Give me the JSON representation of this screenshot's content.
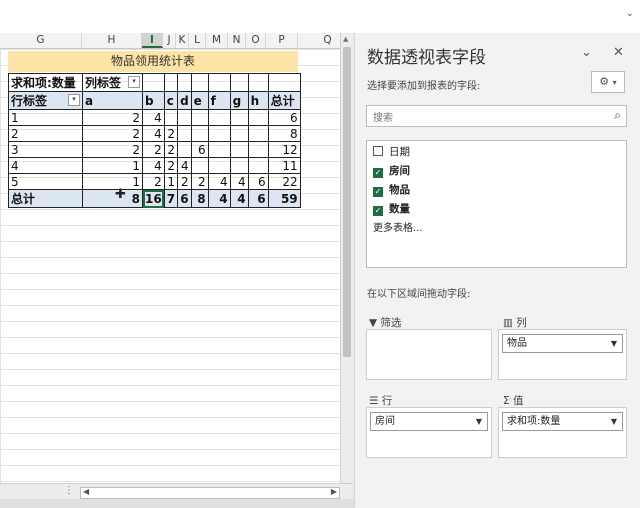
{
  "sheet": {
    "columns": [
      "G",
      "H",
      "I",
      "J",
      "K",
      "L",
      "M",
      "N",
      "O",
      "P",
      "Q"
    ],
    "selected_column": "I",
    "title": "物品领用统计表",
    "pivot": {
      "value_label": "求和项:数量",
      "col_label": "列标签",
      "row_label": "行标签",
      "headers": [
        "a",
        "b",
        "c",
        "d",
        "e",
        "f",
        "g",
        "h",
        "总计"
      ],
      "rows": [
        {
          "label": "1",
          "values": [
            "2",
            "4",
            "",
            "",
            "",
            "",
            "",
            "",
            "6"
          ]
        },
        {
          "label": "2",
          "values": [
            "2",
            "4",
            "2",
            "",
            "",
            "",
            "",
            "",
            "8"
          ]
        },
        {
          "label": "3",
          "values": [
            "2",
            "2",
            "2",
            "",
            "6",
            "",
            "",
            "",
            "12"
          ]
        },
        {
          "label": "4",
          "values": [
            "1",
            "4",
            "2",
            "4",
            "",
            "",
            "",
            "",
            "11"
          ]
        },
        {
          "label": "5",
          "values": [
            "1",
            "2",
            "1",
            "2",
            "2",
            "4",
            "4",
            "6",
            "22"
          ]
        }
      ],
      "total_label": "总计",
      "totals": [
        "8",
        "16",
        "7",
        "6",
        "8",
        "4",
        "4",
        "6",
        "59"
      ]
    }
  },
  "pane": {
    "title": "数据透视表字段",
    "subtitle": "选择要添加到报表的字段:",
    "search_placeholder": "搜索",
    "fields": [
      {
        "name": "日期",
        "checked": false
      },
      {
        "name": "房间",
        "checked": true
      },
      {
        "name": "物品",
        "checked": true
      },
      {
        "name": "数量",
        "checked": true
      }
    ],
    "more_tables": "更多表格...",
    "drag_hint": "在以下区域间拖动字段:",
    "areas": {
      "filter": {
        "label": "筛选",
        "items": []
      },
      "columns": {
        "label": "列",
        "items": [
          "物品"
        ]
      },
      "rows": {
        "label": "行",
        "items": [
          "房间"
        ]
      },
      "values": {
        "label": "值",
        "items": [
          "求和项:数量"
        ]
      }
    }
  },
  "colors": {
    "accent": "#1f6e43",
    "title_fill": "#fce4a6",
    "pivot_header": "#dce6f2"
  }
}
